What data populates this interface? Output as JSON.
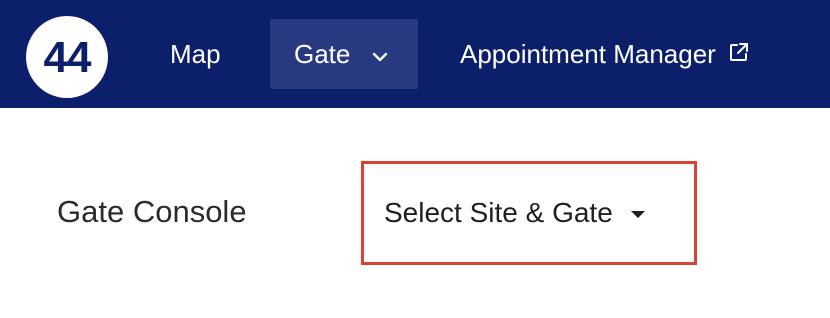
{
  "colors": {
    "nav_background": "#0b1f6b",
    "nav_active_background": "#2a3a82",
    "highlight_border": "#d9432f",
    "logo_background": "#ffffff"
  },
  "logo": {
    "text": "44"
  },
  "nav": {
    "items": [
      {
        "label": "Map",
        "icon": null
      },
      {
        "label": "Gate",
        "icon": "chevron-down-icon",
        "active": true
      },
      {
        "label": "Appointment Manager",
        "icon": "external-link-icon"
      }
    ]
  },
  "page": {
    "title": "Gate Console"
  },
  "site_select": {
    "label": "Select Site & Gate",
    "icon": "caret-down-icon"
  }
}
